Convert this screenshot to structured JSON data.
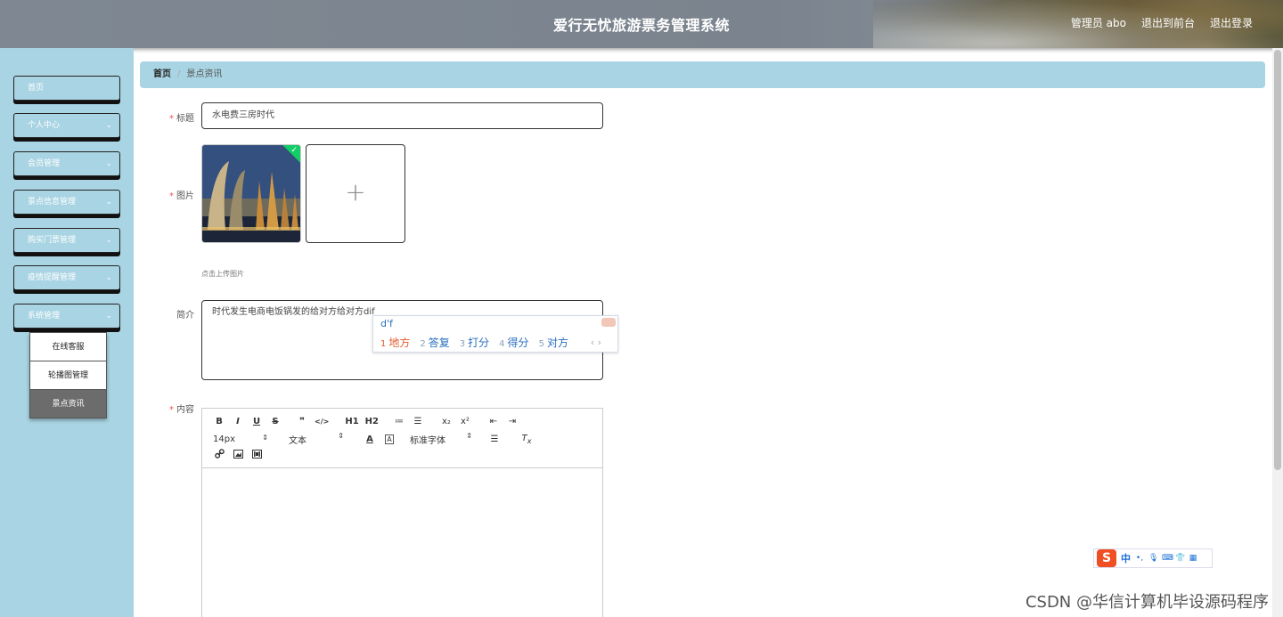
{
  "app": {
    "title": "爱行无忧旅游票务管理系统"
  },
  "header": {
    "user": "管理员 abo",
    "to_front": "退出到前台",
    "logout": "退出登录"
  },
  "sidebar": {
    "items": [
      {
        "label": "首页",
        "expandable": false
      },
      {
        "label": "个人中心",
        "expandable": true
      },
      {
        "label": "会员管理",
        "expandable": true
      },
      {
        "label": "景点信息管理",
        "expandable": true
      },
      {
        "label": "购买门票管理",
        "expandable": true
      },
      {
        "label": "疫情提醒管理",
        "expandable": true
      },
      {
        "label": "系统管理",
        "expandable": true,
        "expanded": true
      }
    ],
    "submenu": [
      {
        "label": "在线客服",
        "active": false
      },
      {
        "label": "轮播图管理",
        "active": false
      },
      {
        "label": "景点资讯",
        "active": true
      }
    ]
  },
  "breadcrumb": {
    "home": "首页",
    "separator": "/",
    "current": "景点资讯"
  },
  "form": {
    "title": {
      "label": "标题",
      "required": true,
      "value": "水电费三房时代"
    },
    "image": {
      "label": "图片",
      "required": true,
      "upload_hint": "点击上传图片",
      "uploaded": true
    },
    "intro": {
      "label": "简介",
      "required": false,
      "value": "时代发生电商电饭锅发的给对方给对方dif"
    },
    "content": {
      "label": "内容",
      "required": true
    }
  },
  "ime": {
    "pinyin": "d'f",
    "candidates": [
      {
        "num": "1",
        "text": "地方"
      },
      {
        "num": "2",
        "text": "答复"
      },
      {
        "num": "3",
        "text": "打分"
      },
      {
        "num": "4",
        "text": "得分"
      },
      {
        "num": "5",
        "text": "对方"
      }
    ],
    "nav": "‹ ›"
  },
  "editor": {
    "row1": [
      "B",
      "I",
      "U",
      "S",
      "❞",
      "</>",
      "H1",
      "H2",
      "≔",
      "☰",
      "x₂",
      "x²",
      "⇤",
      "⇥"
    ],
    "font_size": "14px",
    "block_type": "文本",
    "font_family": "标准字体",
    "row3": [
      "link-icon",
      "image-icon",
      "video-icon"
    ]
  },
  "sogou": {
    "logo": "S",
    "mode": "中"
  },
  "watermark": "CSDN @华信计算机毕设源码程序",
  "colors": {
    "sidebar": "#a9d4e3",
    "accent_success": "#13ce66",
    "required": "#e55555"
  }
}
